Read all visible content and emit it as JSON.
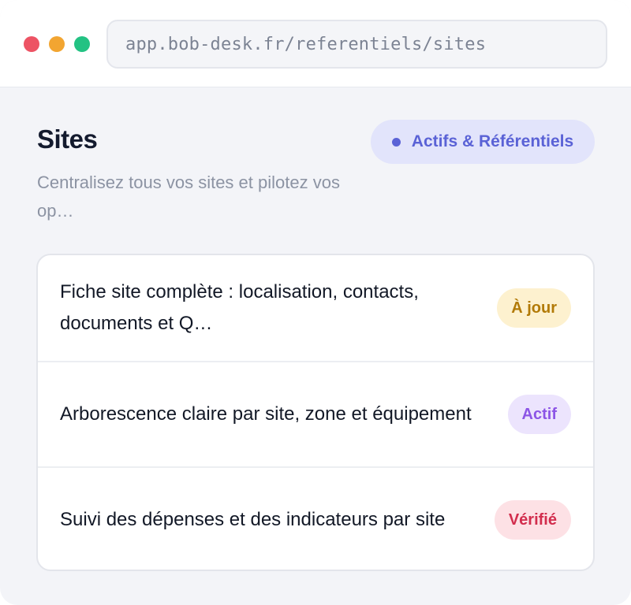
{
  "browser": {
    "url": "app.bob-desk.fr/referentiels/sites"
  },
  "header": {
    "title": "Sites",
    "subtitle": "Centralisez tous vos sites et pilotez vos op…",
    "category_badge": "Actifs & Référentiels"
  },
  "features": [
    {
      "text": "Fiche site complète : localisation, contacts, documents et Q…",
      "status": "À jour",
      "status_color": "#b27a07"
    },
    {
      "text": "Arborescence claire par site, zone et équipement",
      "status": "Actif",
      "status_color": "#8c55e6"
    },
    {
      "text": "Suivi des dépenses et des indicateurs par site",
      "status": "Vérifié",
      "status_color": "#d22d4d"
    }
  ],
  "colors": {
    "accent": "#5a62d6",
    "traffic_red": "#ed5364",
    "traffic_yellow": "#f2a531",
    "traffic_green": "#23c283"
  }
}
